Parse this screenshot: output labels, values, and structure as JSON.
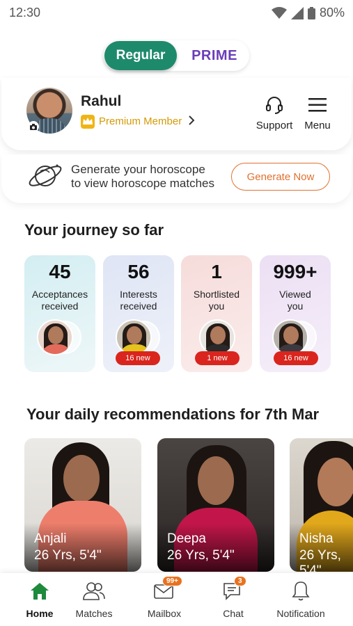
{
  "status_bar": {
    "time": "12:30",
    "battery": "80%"
  },
  "toggle": {
    "regular": "Regular",
    "prime": "PRIME"
  },
  "profile": {
    "name": "Rahul",
    "membership": "Premium Member"
  },
  "header_actions": {
    "support": "Support",
    "menu": "Menu"
  },
  "horoscope": {
    "line1": "Generate your horoscope",
    "line2": "to view horoscope matches",
    "button": "Generate Now"
  },
  "journey": {
    "title": "Your journey so far",
    "cards": [
      {
        "count": "45",
        "label1": "Acceptances",
        "label2": "received",
        "badge": "",
        "bg": "#d9eff3"
      },
      {
        "count": "56",
        "label1": "Interests",
        "label2": "received",
        "badge": "16 new",
        "bg": "#e3e8f6"
      },
      {
        "count": "1",
        "label1": "Shortlisted",
        "label2": "you",
        "badge": "1 new",
        "bg": "#f8e1e0"
      },
      {
        "count": "999+",
        "label1": "Viewed",
        "label2": "you",
        "badge": "16 new",
        "bg": "#efe3f5"
      }
    ]
  },
  "recommendations": {
    "title": "Your daily recommendations for 7th Mar",
    "profiles": [
      {
        "name": "Anjali",
        "info": "26 Yrs,  5'4\""
      },
      {
        "name": "Deepa",
        "info": "26 Yrs,  5'4\""
      },
      {
        "name": "Nisha",
        "info": "26 Yrs,  5'4\""
      }
    ]
  },
  "bottom_nav": {
    "home": "Home",
    "matches": "Matches",
    "mailbox": "Mailbox",
    "mailbox_count": "99+",
    "chat": "Chat",
    "chat_count": "3",
    "notification": "Notification"
  },
  "colors": {
    "primary_green": "#1e8a6c",
    "prime_purple": "#6a3db8",
    "accent_orange": "#e07030",
    "badge_red": "#d9251d",
    "premium_gold": "#d49a06"
  }
}
